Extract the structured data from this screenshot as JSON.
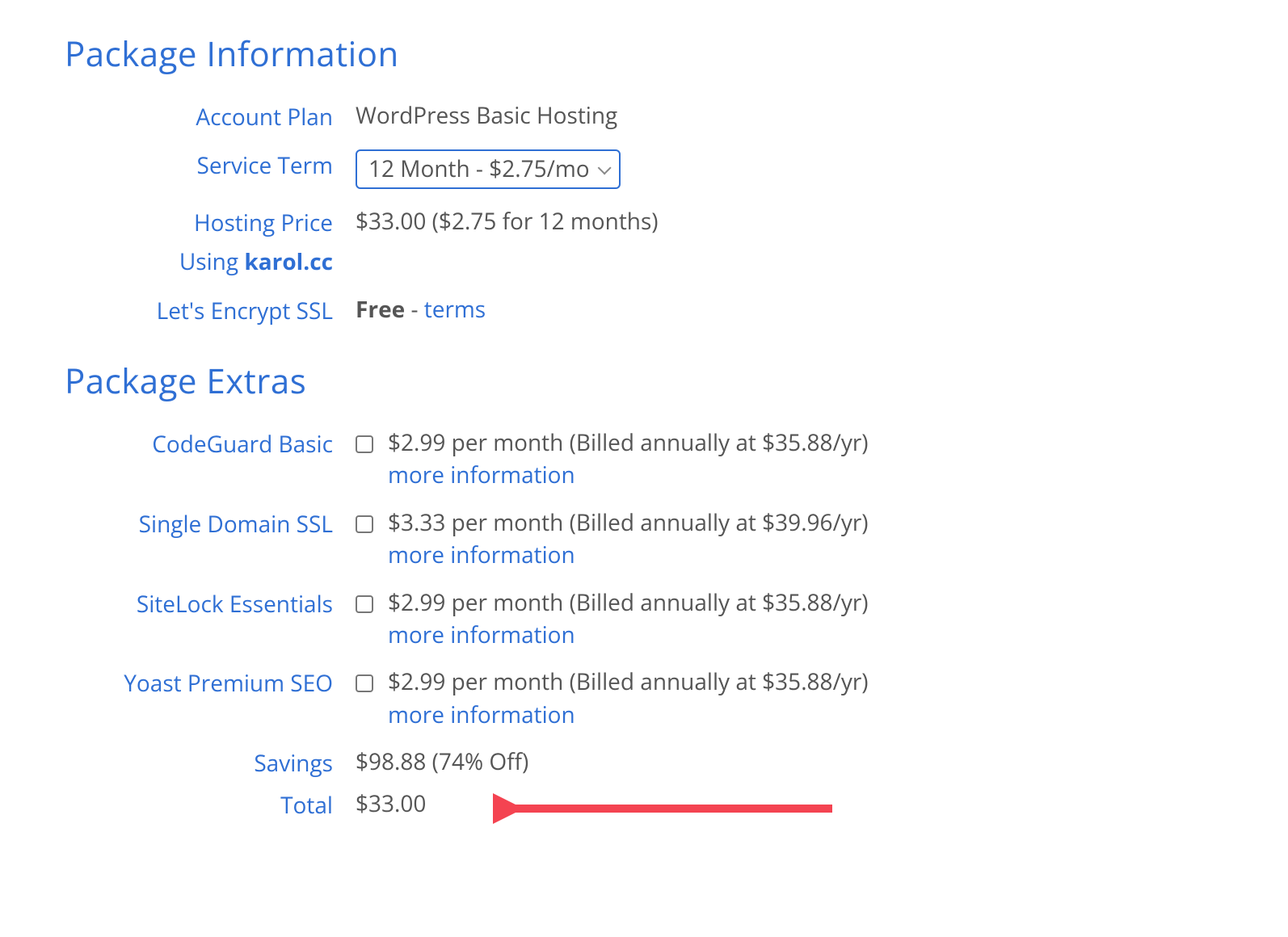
{
  "section1_title": "Package Information",
  "info": {
    "account_plan_label": "Account Plan",
    "account_plan_value": "WordPress Basic Hosting",
    "service_term_label": "Service Term",
    "service_term_value": "12 Month - $2.75/mo",
    "hosting_price_label": "Hosting Price",
    "hosting_price_value": "$33.00 ($2.75 for 12 months)",
    "using_label_prefix": "Using ",
    "using_domain": "karol.cc",
    "ssl_label": "Let's Encrypt SSL",
    "ssl_free": "Free",
    "ssl_dash": " - ",
    "ssl_terms": "terms"
  },
  "section2_title": "Package Extras",
  "extras": [
    {
      "label": "CodeGuard Basic",
      "price": "$2.99 per month (Billed annually at $35.88/yr)",
      "more": "more information"
    },
    {
      "label": "Single Domain SSL",
      "price": "$3.33 per month (Billed annually at $39.96/yr)",
      "more": "more information"
    },
    {
      "label": "SiteLock Essentials",
      "price": "$2.99 per month (Billed annually at $35.88/yr)",
      "more": "more information"
    },
    {
      "label": "Yoast Premium SEO",
      "price": "$2.99 per month (Billed annually at $35.88/yr)",
      "more": "more information"
    }
  ],
  "savings_label": "Savings",
  "savings_value": "$98.88 (74% Off)",
  "total_label": "Total",
  "total_value": "$33.00"
}
